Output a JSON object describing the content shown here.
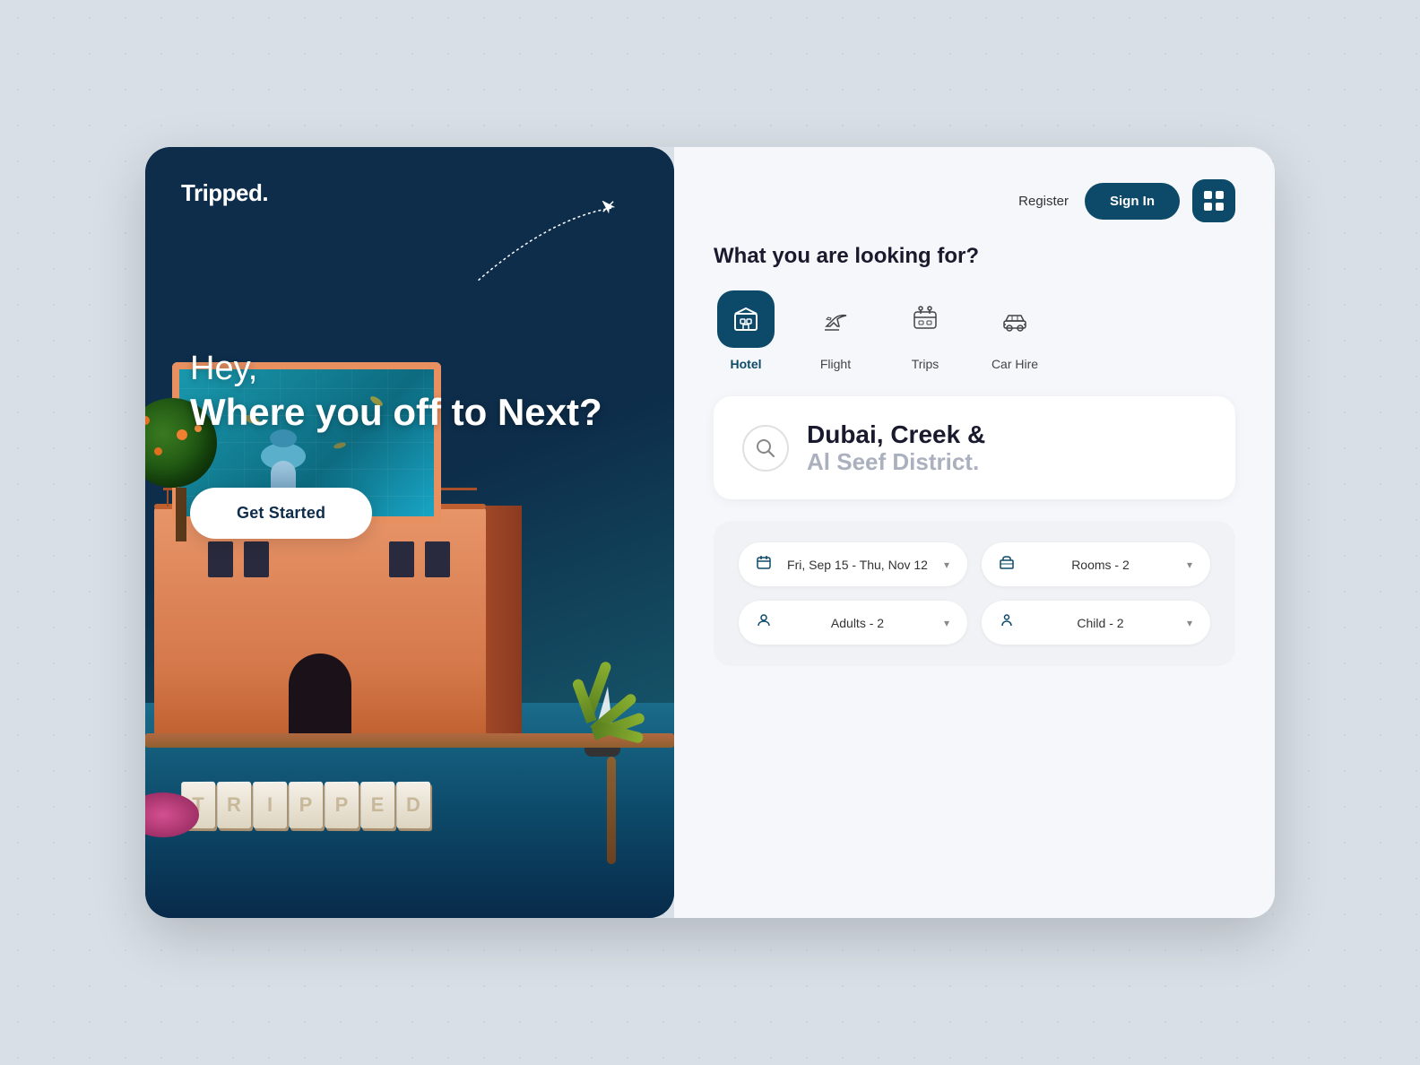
{
  "app": {
    "logo": "Tripped.",
    "tagline_line1": "Hey,",
    "tagline_line2": "Where you off to Next?",
    "get_started": "Get Started"
  },
  "header": {
    "register": "Register",
    "sign_in": "Sign In"
  },
  "search_section": {
    "heading": "What you are looking for?",
    "categories": [
      {
        "id": "hotel",
        "label": "Hotel",
        "active": true
      },
      {
        "id": "flight",
        "label": "Flight",
        "active": false
      },
      {
        "id": "trips",
        "label": "Trips",
        "active": false
      },
      {
        "id": "car-hire",
        "label": "Car Hire",
        "active": false
      }
    ]
  },
  "location": {
    "main": "Dubai, Creek &",
    "sub": "Al Seef District."
  },
  "booking": {
    "dates": "Fri, Sep 15 - Thu, Nov 12",
    "rooms": "Rooms - 2",
    "adults": "Adults - 2",
    "child": "Child - 2"
  },
  "icons": {
    "hotel": "🏨",
    "flight": "✈",
    "trips": "🗺",
    "car_hire": "🚗",
    "search": "🔍",
    "calendar": "📅",
    "bed": "🛏",
    "person": "👤"
  }
}
